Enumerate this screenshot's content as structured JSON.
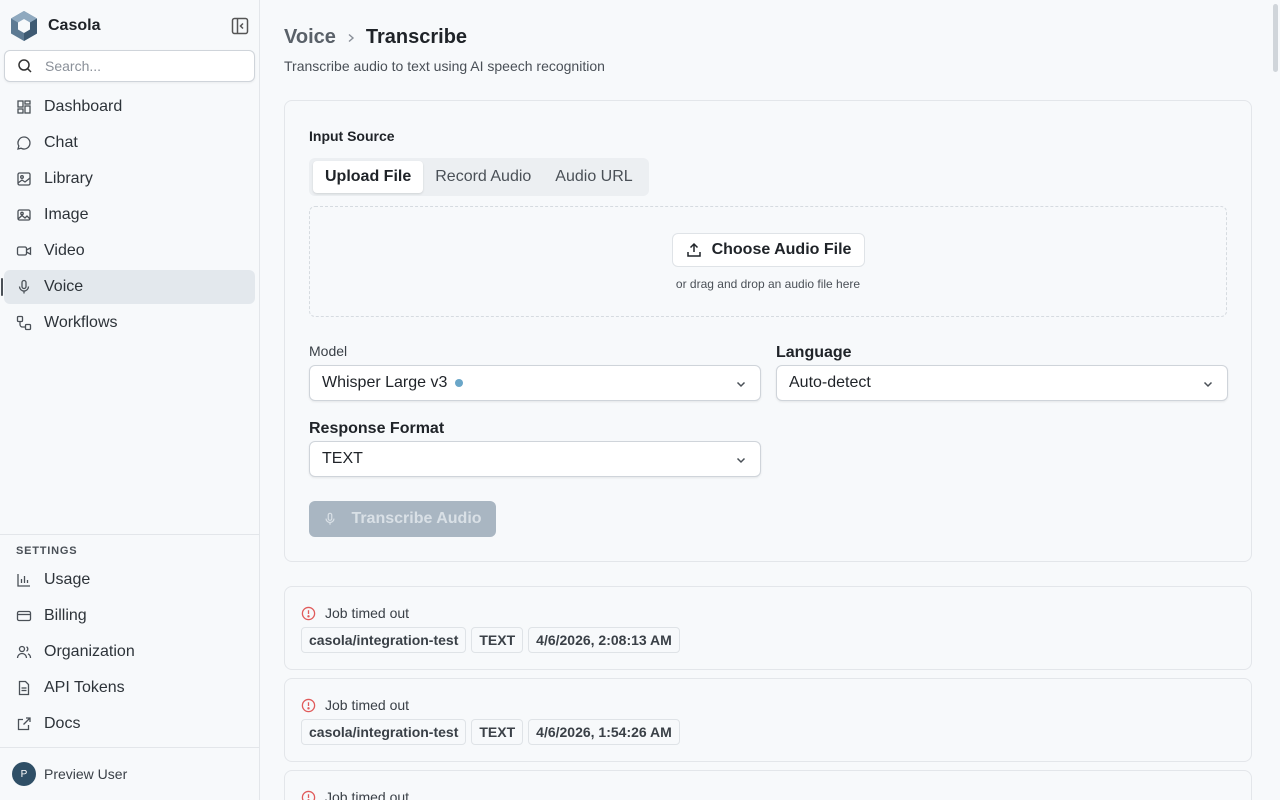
{
  "app": {
    "name": "Casola"
  },
  "search": {
    "placeholder": "Search..."
  },
  "nav": {
    "items": [
      {
        "label": "Dashboard",
        "icon": "dashboard-icon"
      },
      {
        "label": "Chat",
        "icon": "chat-icon"
      },
      {
        "label": "Library",
        "icon": "library-icon"
      },
      {
        "label": "Image",
        "icon": "image-icon"
      },
      {
        "label": "Video",
        "icon": "video-icon"
      },
      {
        "label": "Voice",
        "icon": "microphone-icon",
        "active": true
      },
      {
        "label": "Workflows",
        "icon": "workflow-icon"
      }
    ]
  },
  "settings": {
    "heading": "SETTINGS",
    "items": [
      {
        "label": "Usage",
        "icon": "bar-chart-icon"
      },
      {
        "label": "Billing",
        "icon": "credit-card-icon"
      },
      {
        "label": "Organization",
        "icon": "users-icon"
      },
      {
        "label": "API Tokens",
        "icon": "document-icon"
      },
      {
        "label": "Docs",
        "icon": "external-link-icon"
      }
    ]
  },
  "user": {
    "initial": "P",
    "name": "Preview User"
  },
  "page": {
    "breadcrumb_parent": "Voice",
    "breadcrumb_current": "Transcribe",
    "subtitle": "Transcribe audio to text using AI speech recognition"
  },
  "form": {
    "input_source_label": "Input Source",
    "tabs": [
      "Upload File",
      "Record Audio",
      "Audio URL"
    ],
    "active_tab": "Upload File",
    "choose_file_label": "Choose Audio File",
    "drop_hint": "or drag and drop an audio file here",
    "model_label": "Model",
    "model_value": "Whisper Large v3",
    "language_label": "Language",
    "language_value": "Auto-detect",
    "format_label": "Response Format",
    "format_value": "TEXT",
    "submit_label": "Transcribe Audio"
  },
  "jobs": [
    {
      "status": "Job timed out",
      "model": "casola/integration-test",
      "format": "TEXT",
      "time": "4/6/2026, 2:08:13 AM"
    },
    {
      "status": "Job timed out",
      "model": "casola/integration-test",
      "format": "TEXT",
      "time": "4/6/2026, 1:54:26 AM"
    },
    {
      "status": "Job timed out"
    }
  ],
  "colors": {
    "accent_dot": "#6aa6c8",
    "error": "#e05a5a",
    "disabled_button": "#a9b6c2"
  }
}
